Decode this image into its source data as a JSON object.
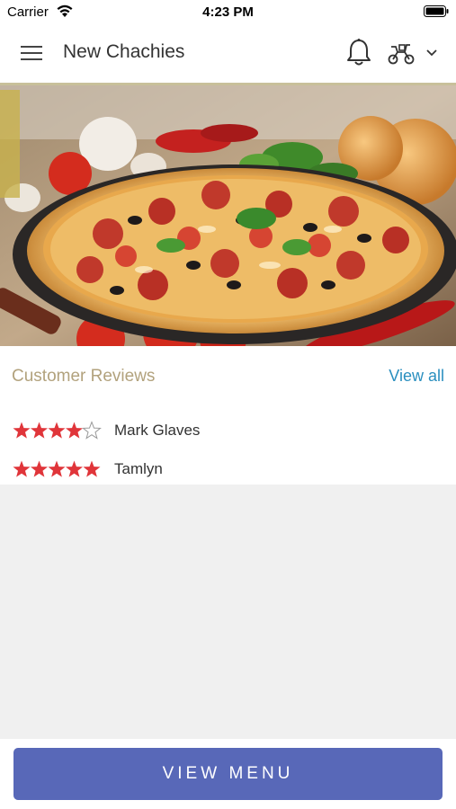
{
  "status_bar": {
    "carrier": "Carrier",
    "time": "4:23 PM"
  },
  "nav": {
    "title": "New Chachies"
  },
  "reviews": {
    "title": "Customer Reviews",
    "view_all_label": "View all",
    "items": [
      {
        "name": "Mark Glaves",
        "rating": 4
      },
      {
        "name": "Tamlyn",
        "rating": 5
      }
    ]
  },
  "footer": {
    "view_menu_label": "VIEW MENU"
  },
  "colors": {
    "star": "#e0353a",
    "accent_blue": "#2a8fbf",
    "button": "#5868b8",
    "reviews_title": "#b2a27d"
  }
}
